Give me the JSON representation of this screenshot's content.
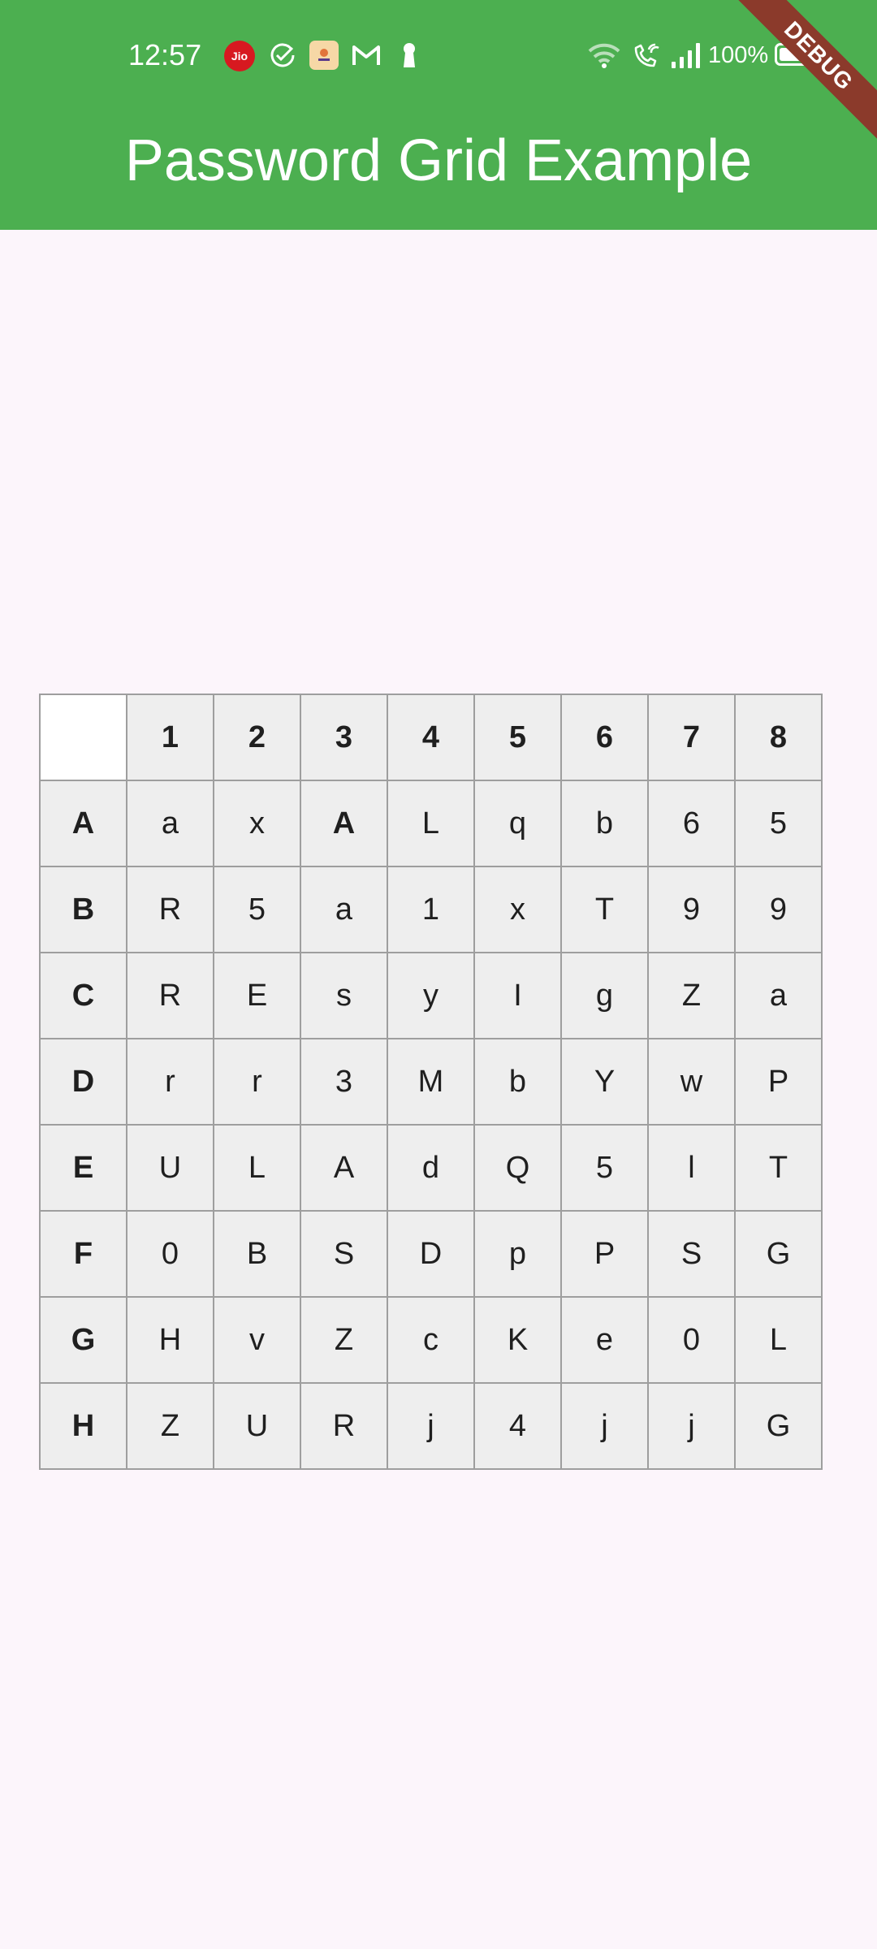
{
  "status_bar": {
    "time": "12:57",
    "jio_label": "Jio",
    "battery": "100%",
    "icons": [
      "jio-icon",
      "check-circle-icon",
      "app-icon",
      "gmail-icon",
      "keyhole-icon",
      "wifi-icon",
      "wifi-calling-icon",
      "signal-icon",
      "battery-icon"
    ]
  },
  "debug_banner": "DEBUG",
  "app_bar": {
    "title": "Password Grid Example",
    "color": "#4caf50"
  },
  "grid": {
    "columns": [
      "1",
      "2",
      "3",
      "4",
      "5",
      "6",
      "7",
      "8"
    ],
    "rows": [
      {
        "label": "A",
        "cells": [
          "a",
          "x",
          "A",
          "L",
          "q",
          "b",
          "6",
          "5"
        ]
      },
      {
        "label": "B",
        "cells": [
          "R",
          "5",
          "a",
          "1",
          "x",
          "T",
          "9",
          "9"
        ]
      },
      {
        "label": "C",
        "cells": [
          "R",
          "E",
          "s",
          "y",
          "I",
          "g",
          "Z",
          "a"
        ]
      },
      {
        "label": "D",
        "cells": [
          "r",
          "r",
          "3",
          "M",
          "b",
          "Y",
          "w",
          "P"
        ]
      },
      {
        "label": "E",
        "cells": [
          "U",
          "L",
          "A",
          "d",
          "Q",
          "5",
          "l",
          "T"
        ]
      },
      {
        "label": "F",
        "cells": [
          "0",
          "B",
          "S",
          "D",
          "p",
          "P",
          "S",
          "G"
        ]
      },
      {
        "label": "G",
        "cells": [
          "H",
          "v",
          "Z",
          "c",
          "K",
          "e",
          "0",
          "L"
        ]
      },
      {
        "label": "H",
        "cells": [
          "Z",
          "U",
          "R",
          "j",
          "4",
          "j",
          "j",
          "G"
        ]
      }
    ]
  }
}
